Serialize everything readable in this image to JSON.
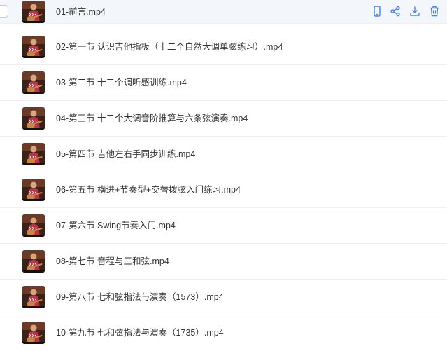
{
  "files": [
    {
      "name": "01-前言.mp4"
    },
    {
      "name": "02-第一节 认识吉他指板（十二个自然大调单弦练习）.mp4"
    },
    {
      "name": "03-第二节 十二个调听感训练.mp4"
    },
    {
      "name": "04-第三节 十二个大调音阶推算与六条弦演奏.mp4"
    },
    {
      "name": "05-第四节 吉他左右手同步训练.mp4"
    },
    {
      "name": "06-第五节 横进+节奏型+交替拨弦入门练习.mp4"
    },
    {
      "name": "07-第六节 Swing节奏入门.mp4"
    },
    {
      "name": "08-第七节 音程与三和弦.mp4"
    },
    {
      "name": "09-第八节 七和弦指法与演奏（1573）.mp4"
    },
    {
      "name": "10-第九节 七和弦指法与演奏（1735）.mp4"
    }
  ],
  "row_actions": {
    "icons": [
      "phone-icon",
      "share-icon",
      "download-icon",
      "delete-icon"
    ]
  },
  "colors": {
    "accent": "#4a7ff0",
    "hover_row": "#f3f6fb",
    "separator": "#eef0f3",
    "text": "#333333"
  }
}
